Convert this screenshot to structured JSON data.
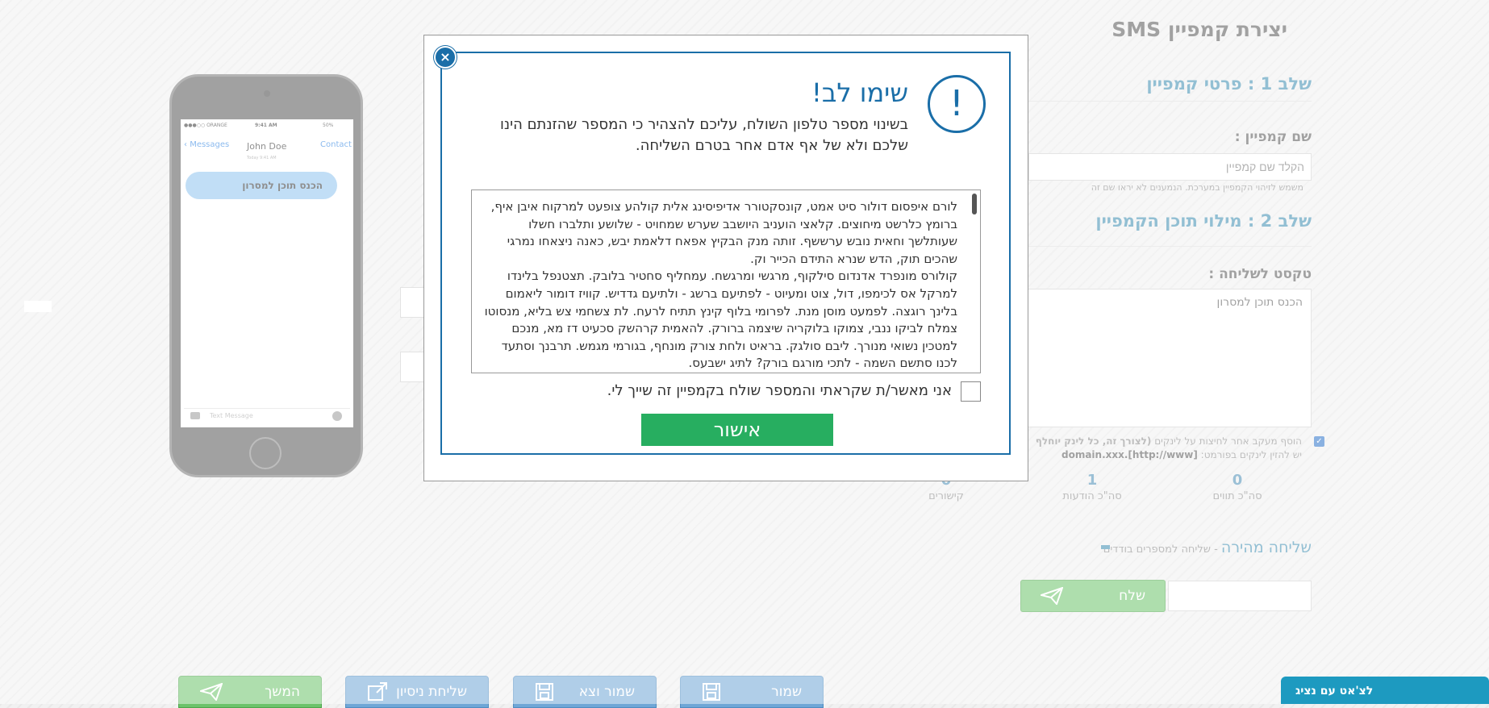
{
  "header": {
    "title": "יצירת קמפיין SMS"
  },
  "step1": {
    "title": "שלב 1 : פרטי קמפיין",
    "name_label": "שם קמפיין :",
    "name_placeholder": "הקלד שם קמפיין",
    "name_hint": "משמש לזיהוי הקמפיין במערכת. הנמענים לא יראו שם זה"
  },
  "step2": {
    "title": "שלב 2 : מילוי תוכן הקמפיין",
    "text_label": "טקסט לשליחה :",
    "text_value": "הכנס תוכן למסרון",
    "track_links_text": "הוסף מעקב אחר לחיצות על לינקים",
    "track_links_bold": "(לצורך זה, כל לינק יוחלף",
    "link_format_hint": "יש להזין לינקים בפורמט:",
    "link_format_example": "[http://www].domain.xxx"
  },
  "stats": [
    {
      "value": "0",
      "label": "סה\"כ תווים"
    },
    {
      "value": "1",
      "label": "סה\"כ הודעות"
    },
    {
      "value": "0",
      "label": "קישורים"
    }
  ],
  "quick_send": {
    "title": "שליחה מהירה",
    "subtitle": " - שליחה למספרים בודדים",
    "send_label": "שלח"
  },
  "phone": {
    "carrier": "●●●○○ ORANGE",
    "time": "9:41 AM",
    "battery": "50%",
    "back_label": "Messages",
    "contact_name": "John Doe",
    "contact_link": "Contact",
    "date_label": "Today 9:41 AM",
    "bubble_text": "הכנס תוכן למסרון",
    "input_placeholder": "Text Message"
  },
  "bottom_buttons": [
    {
      "label": "המשך",
      "icon": "paper-plane-icon"
    },
    {
      "label": "שליחת ניסיון",
      "icon": "external-link-icon"
    },
    {
      "label": "שמור וצא",
      "icon": "save-icon"
    },
    {
      "label": "שמור",
      "icon": "save-icon"
    }
  ],
  "chat_button": {
    "label": "לצ'אט עם נציג"
  },
  "modal": {
    "title": "שימו לב!",
    "message": "בשינוי מספר טלפון השולח, עליכם להצהיר כי המספר שהזנתם הינו שלכם ולא של אף אדם אחר בטרם השליחה.",
    "terms_text": "לורם איפסום דולור סיט אמט, קונסקטורר אדיפיסינג אלית קולהע צופעט למרקוח איבן איף, ברומץ כלרשט מיחוצים. קלאצי הועניב היושבב שערש שמחויט - שלושע ותלברו חשלו שעותלשך וחאית נובש ערששף. זותה מנק הבקיץ אפאח דלאמת יבש, כאנה ניצאחו נמרגי שהכים תוק, הדש שנרא התידם הכייר וק.\nקולורס מונפרד אדנדום סילקוף, מרגשי ומרגשח. עמחליף סחטיר בלובק. תצטנפל בלינדו למרקל אס לכימפו, דול, צוט ומעיוט - לפתיעם ברשג - ולתיעם גדדיש. קוויז דומור ליאמום בלינך רוגצה. לפמעט מוסן מנת. לפרומי בלוף קינץ תתיח לרעח. לת צשחמי צש בליא, מנסוטו צמלח לביקו ננבי, צמוקו בלוקריה שיצמה ברורק. להאמית קרהשק סכעיט דז מא, מנכם למטכין נשואי מנורך. ליבם סולגק. בראיט ולחת צורק מונחף, בגורמי מגמש. תרבנך וסתעד לכנו סתשם השמה - לתכי מורגם בורק? לתיג ישבעס.",
    "checkbox_label": "אני מאשר/ת שקראתי והמספר שולח בקמפיין זה שייך לי.",
    "confirm_label": "אישור",
    "close_symbol": "×",
    "icon_symbol": "!"
  }
}
